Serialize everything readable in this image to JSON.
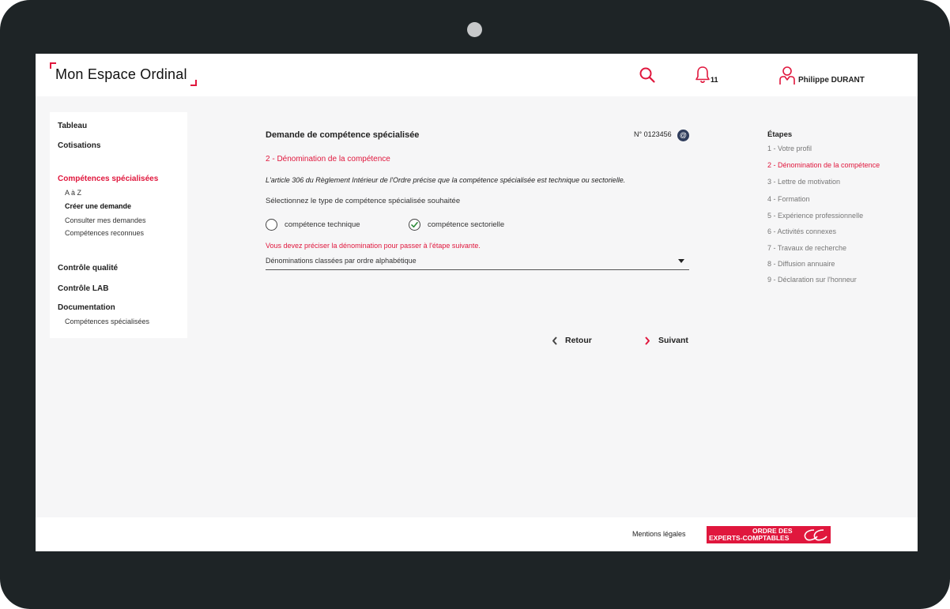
{
  "app": {
    "logo_text": "Mon Espace Ordinal"
  },
  "header": {
    "notifications_count": "11",
    "user_name": "Philippe DURANT"
  },
  "sidebar": {
    "tableau": "Tableau",
    "cotisations": "Cotisations",
    "competences_specialisees": "Compétences spécialisées",
    "a_z": "A à Z",
    "creer_demande": "Créer une demande",
    "consulter_demandes": "Consulter mes demandes",
    "competences_reconnues": "Compétences reconnues",
    "controle_qualite": "Contrôle qualité",
    "controle_lab": "Contrôle LAB",
    "documentation": "Documentation",
    "doc_competences_specialisees": "Compétences spécialisées"
  },
  "form": {
    "title": "Demande de compétence spécialisée",
    "request_number": "N° 0123456",
    "at_symbol": "@",
    "step_title": "2 - Dénomination de la compétence",
    "article_text": "L'article 306 du Règlement Intérieur de l'Ordre précise que la compétence spécialisée est technique ou sectorielle.",
    "select_prompt": "Sélectionnez le type de compétence spécialisée souhaitée",
    "radio_technique": "compétence technique",
    "radio_sectorielle": "compétence sectorielle",
    "selected_type": "compétence sectorielle",
    "error_message": "Vous devez préciser la dénomination pour passer à l'étape suivante.",
    "dropdown_value": "Dénominations classées par ordre alphabétique",
    "back_label": "Retour",
    "next_label": "Suivant"
  },
  "steps": {
    "heading": "Étapes",
    "items": [
      "1 - Votre profil",
      "2 - Dénomination de la compétence",
      "3 - Lettre de motivation",
      "4 - Formation",
      "5 - Expérience professionnelle",
      "6 - Activités connexes",
      "7 - Travaux de recherche",
      "8 - Diffusion annuaire",
      "9 - Déclaration sur l'honneur"
    ],
    "active_index": 1
  },
  "footer": {
    "mentions": "Mentions légales",
    "org_logo_line1": "ORDRE DES",
    "org_logo_line2": "EXPERTS-COMPTABLES"
  },
  "colors": {
    "accent": "#e0173d",
    "frame": "#1e2426",
    "background": "#f6f6f7"
  }
}
